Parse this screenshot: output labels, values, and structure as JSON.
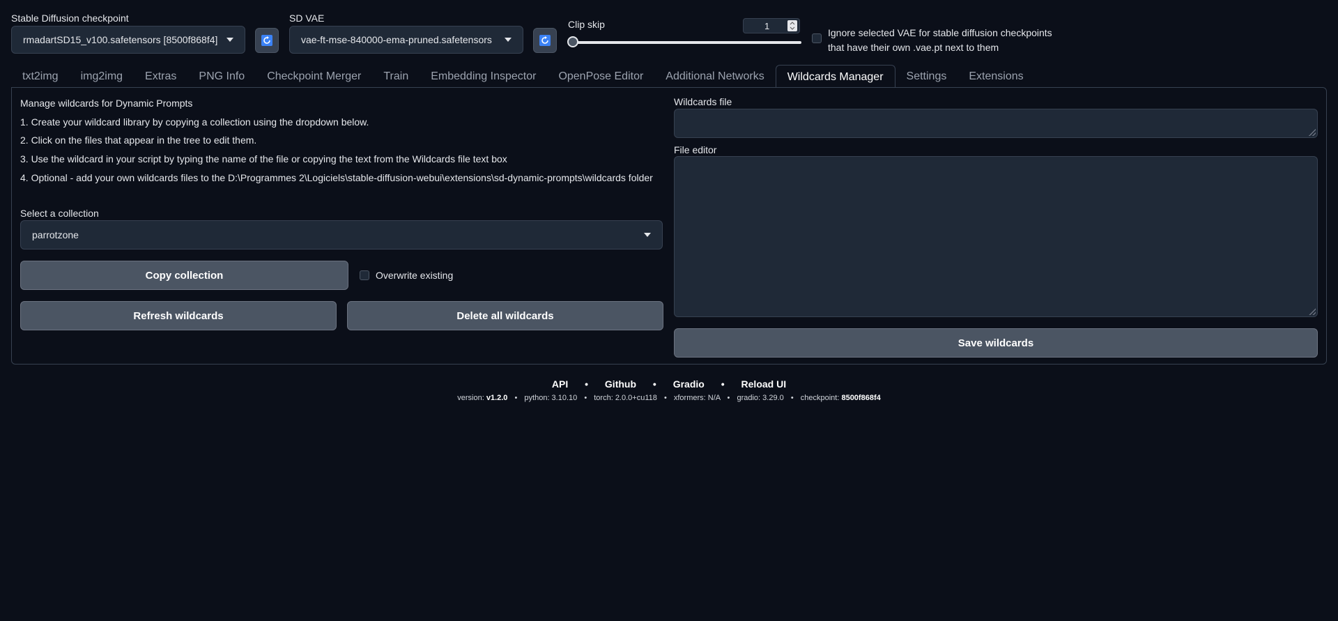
{
  "top": {
    "checkpoint": {
      "label": "Stable Diffusion checkpoint",
      "value": "rmadartSD15_v100.safetensors [8500f868f4]"
    },
    "vae": {
      "label": "SD VAE",
      "value": "vae-ft-mse-840000-ema-pruned.safetensors"
    },
    "clip_skip": {
      "label": "Clip skip",
      "value": "1",
      "fraction": 0.0
    },
    "ignore_vae": {
      "line1": "Ignore selected VAE for stable diffusion checkpoints",
      "line2": "that have their own .vae.pt next to them",
      "checked": false
    }
  },
  "tabs": [
    {
      "label": "txt2img"
    },
    {
      "label": "img2img"
    },
    {
      "label": "Extras"
    },
    {
      "label": "PNG Info"
    },
    {
      "label": "Checkpoint Merger"
    },
    {
      "label": "Train"
    },
    {
      "label": "Embedding Inspector"
    },
    {
      "label": "OpenPose Editor"
    },
    {
      "label": "Additional Networks"
    },
    {
      "label": "Wildcards Manager"
    },
    {
      "label": "Settings"
    },
    {
      "label": "Extensions"
    }
  ],
  "active_tab": "Wildcards Manager",
  "wildcards": {
    "heading": "Manage wildcards for Dynamic Prompts",
    "steps": [
      "1. Create your wildcard library by copying a collection using the dropdown below.",
      "2. Click on the files that appear in the tree to edit them.",
      "3. Use the wildcard in your script by typing the name of the file or copying the text from the Wildcards file text box",
      "4. Optional - add your own wildcards files to the D:\\Programmes 2\\Logiciels\\stable-diffusion-webui\\extensions\\sd-dynamic-prompts\\wildcards folder"
    ],
    "collection_label": "Select a collection",
    "collection_value": "parrotzone",
    "copy_button": "Copy collection",
    "overwrite_label": "Overwrite existing",
    "refresh_button": "Refresh wildcards",
    "delete_button": "Delete all wildcards",
    "file_label": "Wildcards file",
    "file_value": "",
    "editor_label": "File editor",
    "editor_value": "",
    "save_button": "Save wildcards"
  },
  "footer": {
    "links": [
      "API",
      "Github",
      "Gradio",
      "Reload UI"
    ],
    "bullet": "•",
    "info": {
      "version_label": "version:",
      "version": "v1.2.0",
      "python": "python: 3.10.10",
      "torch": "torch: 2.0.0+cu118",
      "xformers": "xformers: N/A",
      "gradio": "gradio: 3.29.0",
      "checkpoint_label": "checkpoint:",
      "checkpoint": "8500f868f4"
    }
  },
  "colors": {
    "background": "#0b0f19",
    "accent": "#3b82f6",
    "button": "#4b5563",
    "input": "#1f2937"
  },
  "icons": {
    "refresh": "refresh-icon",
    "caret": "chevron-down-icon"
  }
}
